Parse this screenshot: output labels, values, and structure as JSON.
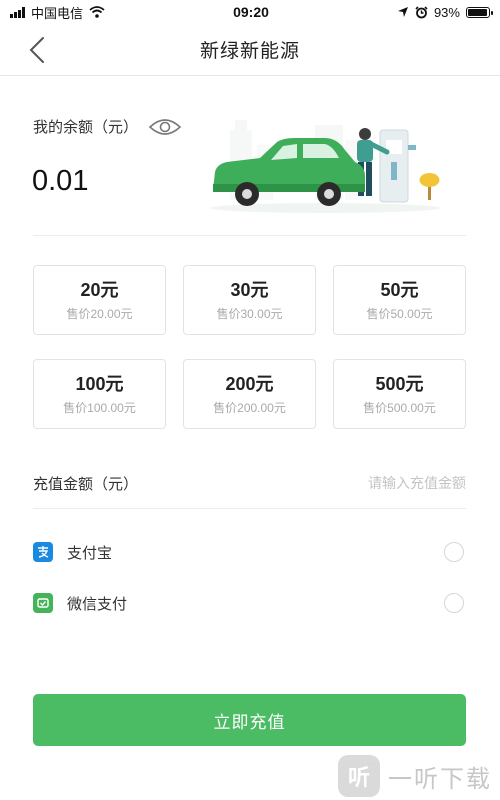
{
  "status_bar": {
    "carrier": "中国电信",
    "time": "09:20",
    "battery": "93%",
    "battery_level": 0.93
  },
  "nav": {
    "title": "新绿新能源"
  },
  "balance": {
    "label": "我的余额（元）",
    "value": "0.01"
  },
  "amounts": [
    {
      "title": "20元",
      "price": "售价20.00元"
    },
    {
      "title": "30元",
      "price": "售价30.00元"
    },
    {
      "title": "50元",
      "price": "售价50.00元"
    },
    {
      "title": "100元",
      "price": "售价100.00元"
    },
    {
      "title": "200元",
      "price": "售价200.00元"
    },
    {
      "title": "500元",
      "price": "售价500.00元"
    }
  ],
  "custom_amount": {
    "label": "充值金额（元）",
    "placeholder": "请输入充值金额"
  },
  "payment_methods": [
    {
      "label": "支付宝",
      "icon": "alipay-icon",
      "color": "#1a8ae0",
      "selected": false
    },
    {
      "label": "微信支付",
      "icon": "wechat-pay-icon",
      "color": "#45b35a",
      "selected": false
    }
  ],
  "submit": {
    "label": "立即充值"
  },
  "watermark": {
    "logo_glyph": "听",
    "text": "一听下载"
  },
  "colors": {
    "accent": "#4cbc64",
    "car": "#3fae5a",
    "border": "#e3e3e3"
  }
}
